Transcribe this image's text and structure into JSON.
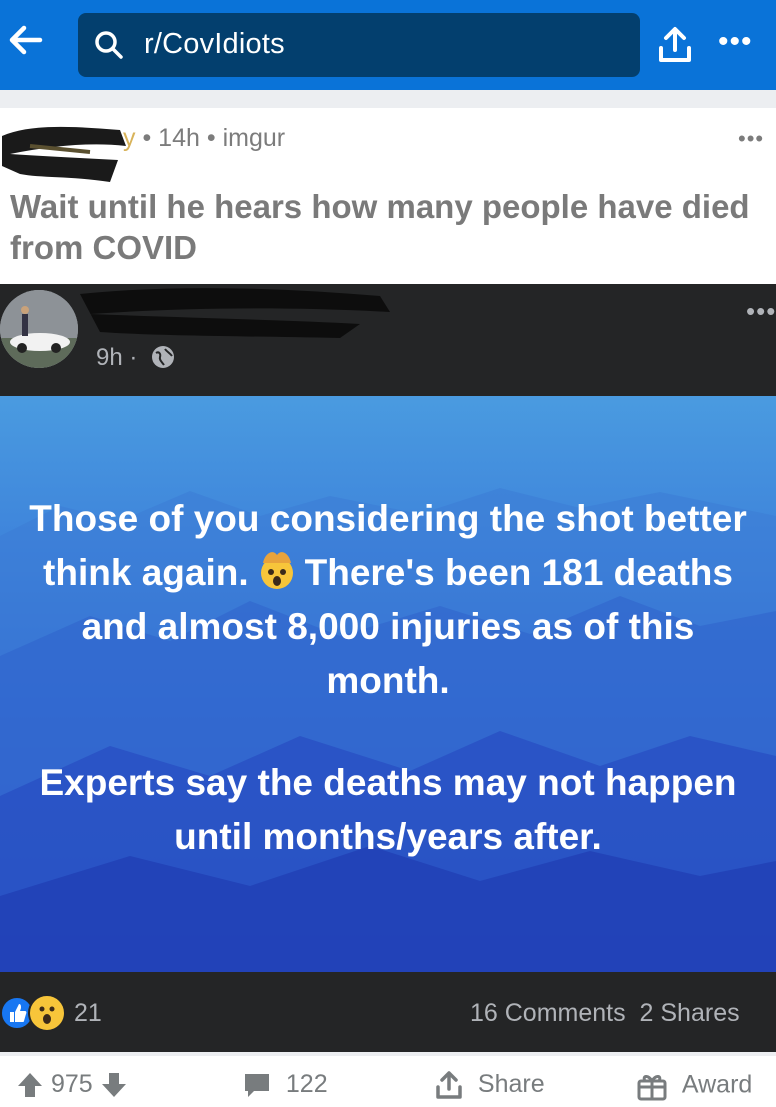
{
  "topbar": {
    "search_query": "r/CovIdiots",
    "back_icon": "arrow-left-icon",
    "share_icon": "share-upload-icon",
    "more_icon": "more-horizontal-icon",
    "bar_color": "#0a73d8",
    "search_bg": "#033f6e"
  },
  "post": {
    "username_tail": "y",
    "age": "14h",
    "source": "imgur",
    "separator": "•",
    "title": "Wait until he hears how many people have died from COVID"
  },
  "fb": {
    "time": "9h",
    "separator": "·",
    "meme_line1": "Those of you considering the shot better think again.",
    "meme_line1_tail": "There's been 181 deaths and almost 8,000 injuries as of this month.",
    "meme_line2": "Experts say the deaths may not happen until months/years after.",
    "reaction_count": "21",
    "comments": "16 Comments",
    "shares": "2 Shares",
    "emoji": "exploding-head-icon"
  },
  "actions": {
    "score": "975",
    "comments": "122",
    "share_label": "Share",
    "award_label": "Award"
  }
}
